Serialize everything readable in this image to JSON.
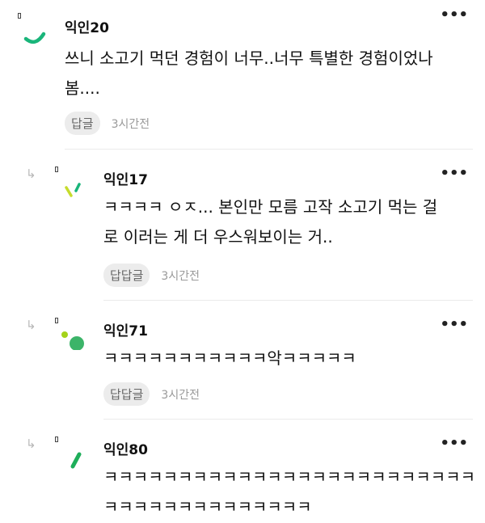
{
  "comments": [
    {
      "name": "익인20",
      "text": "쓰니 소고기 먹던 경험이 너무..너무 특별한 경험이었나\n봄....",
      "reply_label": "답글",
      "time": "3시간전",
      "avatar_color": "#19b57a"
    },
    {
      "name": "익인17",
      "text": "ㅋㅋㅋㅋ ㅇㅈ... 본인만 모름 고작 소고기 먹는 걸\n로 이러는 게 더 우스워보이는 거..",
      "reply_label": "답답글",
      "time": "3시간전",
      "avatar_color": "#c6dc2c"
    },
    {
      "name": "익인71",
      "text": "ㅋㅋㅋㅋㅋㅋㅋㅋㅋㅋㅋ악ㅋㅋㅋㅋㅋ",
      "reply_label": "답답글",
      "time": "3시간전",
      "avatar_color": "#3cb469"
    },
    {
      "name": "익인80",
      "text": "ㅋㅋㅋㅋㅋㅋㅋㅋㅋㅋㅋㅋㅋㅋㅋㅋㅋㅋㅋㅋㅋㅋㅋㅋㅋ\nㅋㅋㅋㅋㅋㅋㅋㅋㅋㅋㅋㅋㅋㅋ",
      "reply_label": "",
      "time": "",
      "avatar_color": "#1eae5a"
    }
  ],
  "icons": {
    "more": "more-options-icon",
    "reply_arrow": "reply-arrow-icon"
  },
  "more_glyph": "•••",
  "reply_arrow_glyph": "↳"
}
